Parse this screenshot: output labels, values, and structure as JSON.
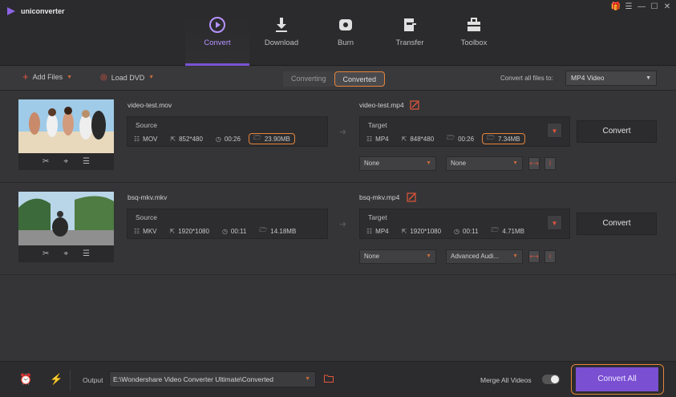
{
  "app": {
    "name": "uniconverter"
  },
  "nav": [
    {
      "label": "Convert",
      "icon": "convert-icon",
      "active": true
    },
    {
      "label": "Download",
      "icon": "download-icon"
    },
    {
      "label": "Burn",
      "icon": "burn-icon"
    },
    {
      "label": "Transfer",
      "icon": "transfer-icon"
    },
    {
      "label": "Toolbox",
      "icon": "toolbox-icon"
    }
  ],
  "toolbar": {
    "add_files": "Add Files",
    "load_dvd": "Load DVD",
    "tab_converting": "Converting",
    "tab_converted": "Converted",
    "convert_all_to_label": "Convert all files to:",
    "format": "MP4 Video"
  },
  "files": [
    {
      "source_name": "video-test.mov",
      "source_header": "Source",
      "source": {
        "format": "MOV",
        "resolution": "852*480",
        "duration": "00:26",
        "size": "23.90MB"
      },
      "target_name": "video-test.mp4",
      "target_header": "Target",
      "target": {
        "format": "MP4",
        "resolution": "848*480",
        "duration": "00:26",
        "size": "7.34MB"
      },
      "subtitle": "None",
      "audio": "None",
      "convert": "Convert"
    },
    {
      "source_name": "bsq-mkv.mkv",
      "source_header": "Source",
      "source": {
        "format": "MKV",
        "resolution": "1920*1080",
        "duration": "00:11",
        "size": "14.18MB"
      },
      "target_name": "bsq-mkv.mp4",
      "target_header": "Target",
      "target": {
        "format": "MP4",
        "resolution": "1920*1080",
        "duration": "00:11",
        "size": "4.71MB"
      },
      "subtitle": "None",
      "audio": "Advanced Audi...",
      "convert": "Convert"
    }
  ],
  "footer": {
    "output_label": "Output",
    "output_path": "E:\\Wondershare Video Converter Ultimate\\Converted",
    "merge_label": "Merge All Videos",
    "merge_on": false,
    "convert_all": "Convert All"
  },
  "colors": {
    "accent": "#7a4fd2",
    "highlight": "#e5843a",
    "red": "#e4553b"
  }
}
